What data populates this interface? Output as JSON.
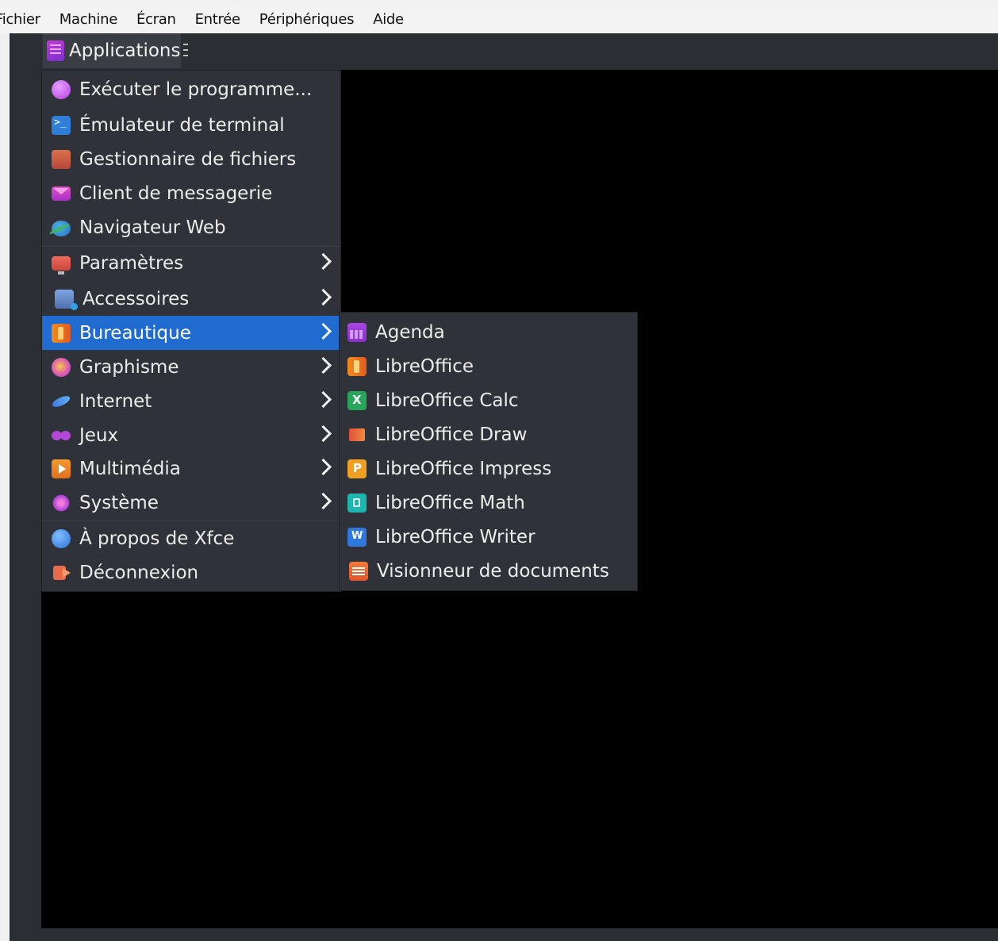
{
  "vm_menubar": [
    "Fichier",
    "Machine",
    "Écran",
    "Entrée",
    "Périphériques",
    "Aide"
  ],
  "panel": {
    "applications_label": "Applications"
  },
  "main_menu": [
    {
      "label": "Exécuter le programme...",
      "icon": "run-program-icon",
      "submenu": false
    },
    {
      "label": "Émulateur de terminal",
      "icon": "terminal-icon",
      "submenu": false
    },
    {
      "label": "Gestionnaire de fichiers",
      "icon": "file-manager-icon",
      "submenu": false
    },
    {
      "label": "Client de messagerie",
      "icon": "mail-icon",
      "submenu": false
    },
    {
      "label": "Navigateur Web",
      "icon": "web-browser-icon",
      "submenu": false
    },
    {
      "label": "Paramètres",
      "icon": "settings-icon",
      "submenu": true
    },
    {
      "label": "Accessoires",
      "icon": "accessories-icon",
      "submenu": true
    },
    {
      "label": "Bureautique",
      "icon": "office-icon",
      "submenu": true,
      "active": true
    },
    {
      "label": "Graphisme",
      "icon": "graphics-icon",
      "submenu": true
    },
    {
      "label": "Internet",
      "icon": "internet-icon",
      "submenu": true
    },
    {
      "label": "Jeux",
      "icon": "games-icon",
      "submenu": true
    },
    {
      "label": "Multimédia",
      "icon": "multimedia-icon",
      "submenu": true
    },
    {
      "label": "Système",
      "icon": "system-icon",
      "submenu": true
    },
    {
      "label": "À propos de Xfce",
      "icon": "about-icon",
      "submenu": false
    },
    {
      "label": "Déconnexion",
      "icon": "logout-icon",
      "submenu": false
    }
  ],
  "sub_menu": [
    {
      "label": "Agenda",
      "icon": "calendar-icon"
    },
    {
      "label": "LibreOffice",
      "icon": "libreoffice-icon"
    },
    {
      "label": "LibreOffice Calc",
      "icon": "calc-icon"
    },
    {
      "label": "LibreOffice Draw",
      "icon": "draw-icon"
    },
    {
      "label": "LibreOffice Impress",
      "icon": "impress-icon"
    },
    {
      "label": "LibreOffice Math",
      "icon": "math-icon"
    },
    {
      "label": "LibreOffice Writer",
      "icon": "writer-icon"
    },
    {
      "label": "Visionneur de documents",
      "icon": "document-viewer-icon"
    }
  ],
  "colors": {
    "highlight": "#1f6bd0",
    "menu_bg": "#2f3238",
    "desktop": "#000000"
  }
}
